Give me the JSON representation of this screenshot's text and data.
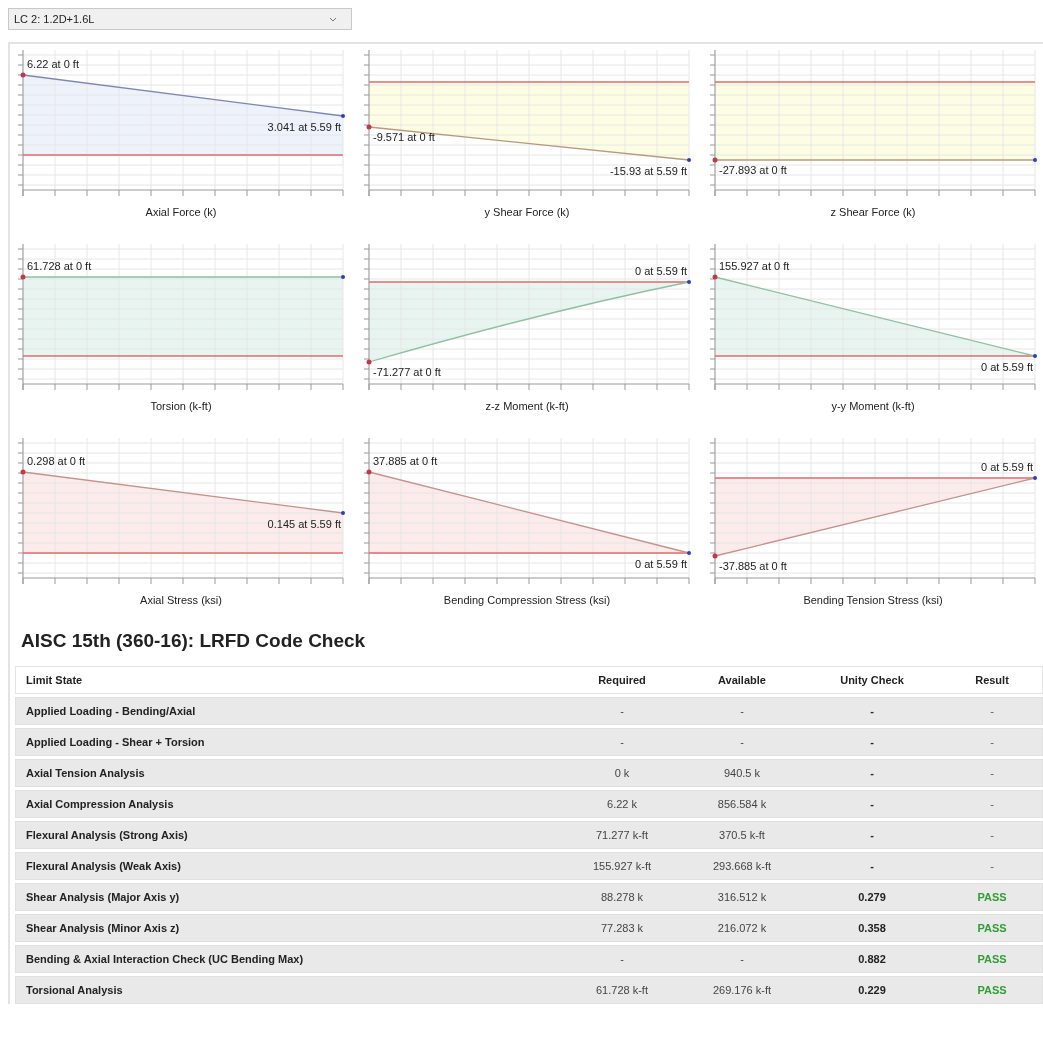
{
  "load_case_select": {
    "value": "LC 2: 1.2D+1.6L"
  },
  "diagrams": [
    {
      "title": "Axial Force (k)",
      "start_label": "6.22 at 0 ft",
      "end_label": "3.041 at 5.59 ft",
      "color": "#edf2fb"
    },
    {
      "title": "y Shear Force (k)",
      "start_label": "-9.571 at 0 ft",
      "end_label": "-15.93 at 5.59 ft",
      "color": "#fdfde4"
    },
    {
      "title": "z Shear Force (k)",
      "start_label": "-27.893 at 0 ft",
      "color": "#fdfde4"
    },
    {
      "title": "Torsion (k-ft)",
      "start_label": "61.728 at 0 ft",
      "color": "#e7f4f0"
    },
    {
      "title": "z-z Moment (k-ft)",
      "start_label": "-71.277 at 0 ft",
      "end_label": "0 at 5.59 ft",
      "color": "#e7f4f0"
    },
    {
      "title": "y-y Moment (k-ft)",
      "start_label": "155.927 at 0 ft",
      "end_label": "0 at 5.59 ft",
      "color": "#e7f4f0"
    },
    {
      "title": "Axial Stress (ksi)",
      "start_label": "0.298 at 0 ft",
      "end_label": "0.145 at 5.59 ft",
      "color": "#fbebea"
    },
    {
      "title": "Bending Compression Stress (ksi)",
      "start_label": "37.885 at 0 ft",
      "end_label": "0 at 5.59 ft",
      "color": "#fbebea"
    },
    {
      "title": "Bending Tension Stress (ksi)",
      "start_label": "-37.885 at 0 ft",
      "end_label": "0 at 5.59 ft",
      "color": "#fbebea"
    }
  ],
  "code_check": {
    "title": "AISC 15th (360-16): LRFD Code Check",
    "columns": [
      "Limit State",
      "Required",
      "Available",
      "Unity Check",
      "Result"
    ],
    "rows": [
      {
        "limit_state": "Applied Loading - Bending/Axial",
        "required": "-",
        "available": "-",
        "unity_check": "-",
        "result": "-",
        "passed": false
      },
      {
        "limit_state": "Applied Loading - Shear + Torsion",
        "required": "-",
        "available": "-",
        "unity_check": "-",
        "result": "-",
        "passed": false
      },
      {
        "limit_state": "Axial Tension Analysis",
        "required": "0 k",
        "available": "940.5 k",
        "unity_check": "-",
        "result": "-",
        "passed": false
      },
      {
        "limit_state": "Axial Compression Analysis",
        "required": "6.22 k",
        "available": "856.584 k",
        "unity_check": "-",
        "result": "-",
        "passed": false
      },
      {
        "limit_state": "Flexural Analysis (Strong Axis)",
        "required": "71.277 k-ft",
        "available": "370.5 k-ft",
        "unity_check": "-",
        "result": "-",
        "passed": false
      },
      {
        "limit_state": "Flexural Analysis (Weak Axis)",
        "required": "155.927 k-ft",
        "available": "293.668 k-ft",
        "unity_check": "-",
        "result": "-",
        "passed": false
      },
      {
        "limit_state": "Shear Analysis (Major Axis y)",
        "required": "88.278 k",
        "available": "316.512 k",
        "unity_check": "0.279",
        "result": "PASS",
        "passed": true
      },
      {
        "limit_state": "Shear Analysis (Minor Axis z)",
        "required": "77.283 k",
        "available": "216.072 k",
        "unity_check": "0.358",
        "result": "PASS",
        "passed": true
      },
      {
        "limit_state": "Bending & Axial Interaction Check (UC Bending Max)",
        "required": "-",
        "available": "-",
        "unity_check": "0.882",
        "result": "PASS",
        "passed": true
      },
      {
        "limit_state": "Torsional Analysis",
        "required": "61.728 k-ft",
        "available": "269.176 k-ft",
        "unity_check": "0.229",
        "result": "PASS",
        "passed": true
      }
    ]
  }
}
